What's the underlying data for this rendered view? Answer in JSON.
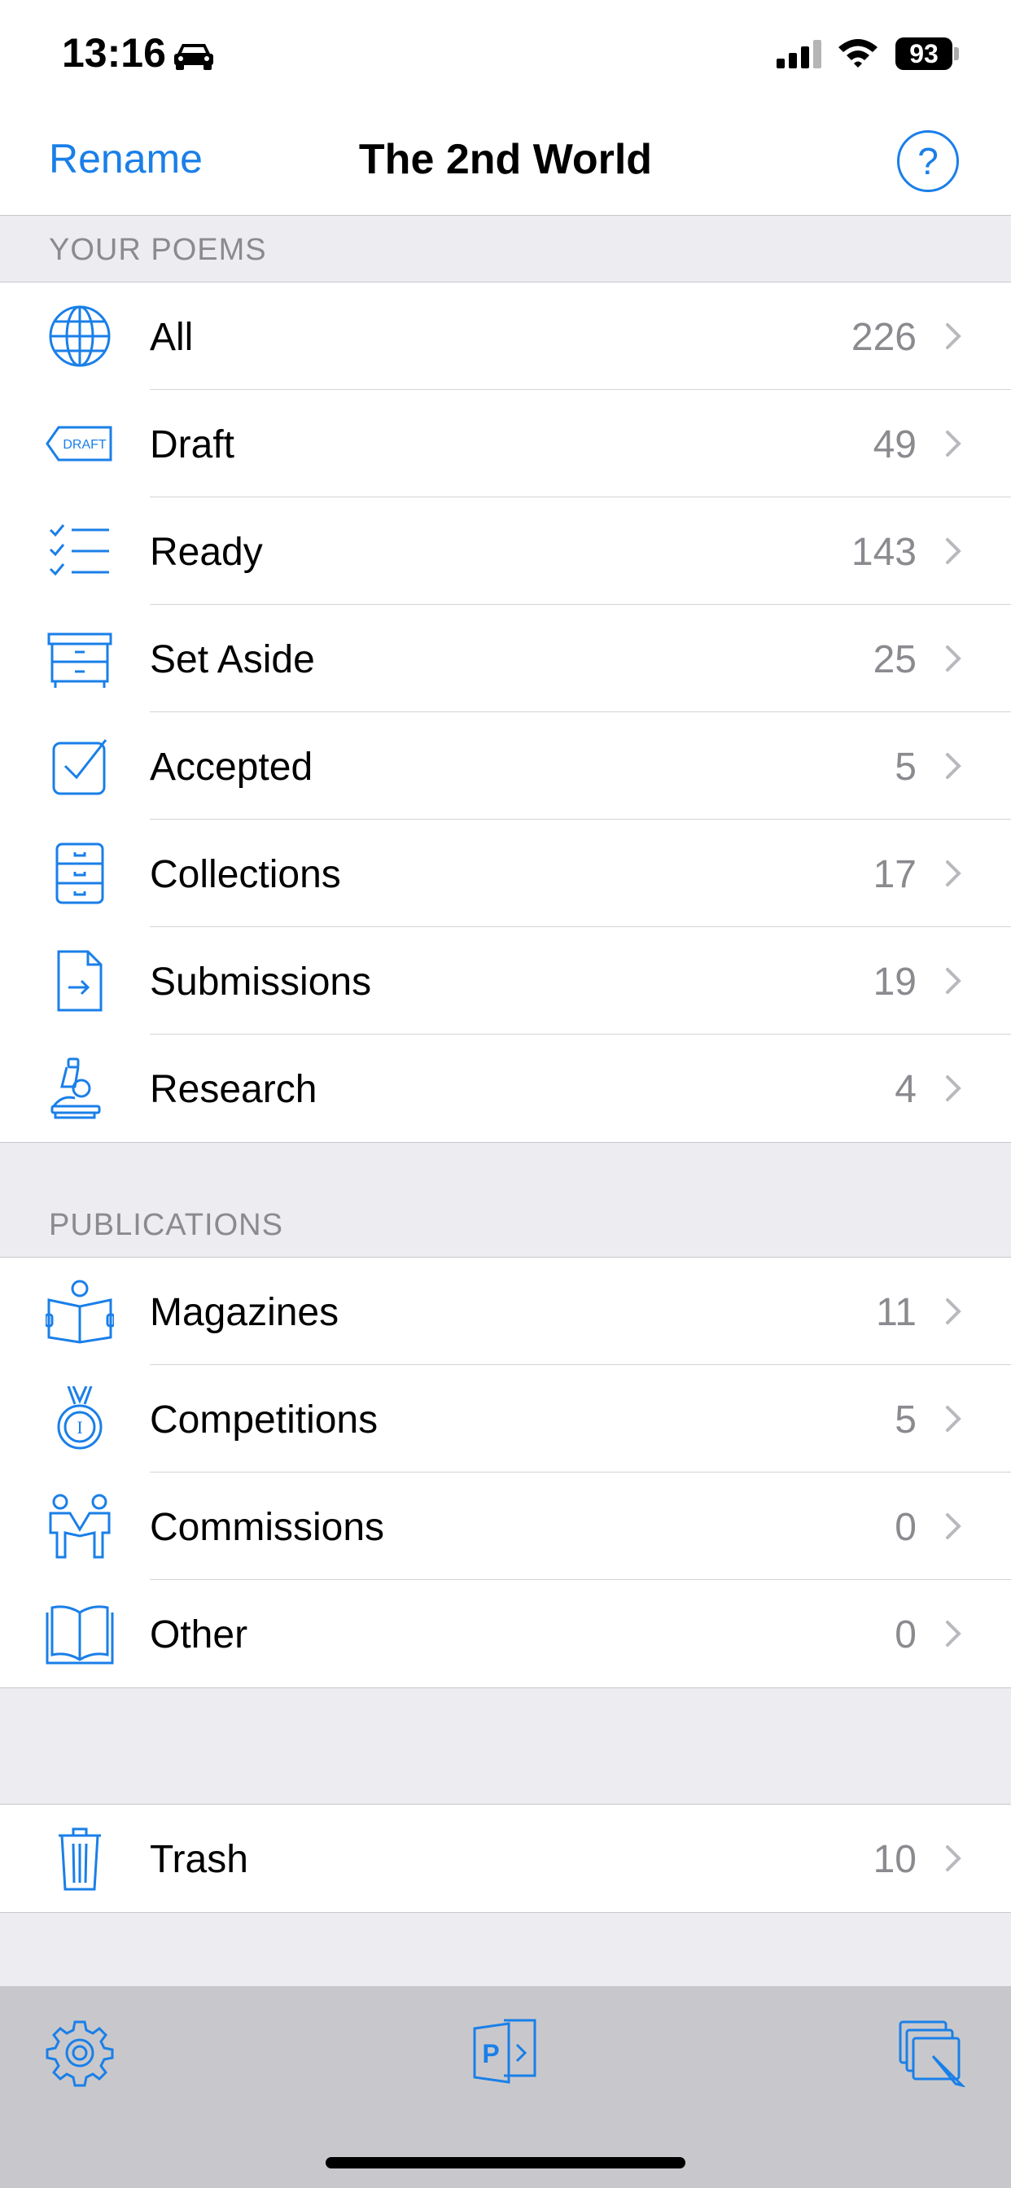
{
  "status": {
    "time": "13:16",
    "battery": "93"
  },
  "nav": {
    "left_label": "Rename",
    "title": "The 2nd World",
    "help": "?"
  },
  "colors": {
    "accent": "#1a7fe8"
  },
  "sections": [
    {
      "header": "YOUR POEMS",
      "items": [
        {
          "label": "All",
          "count": "226",
          "icon": "globe-icon"
        },
        {
          "label": "Draft",
          "count": "49",
          "icon": "draft-tag-icon",
          "icon_text": "DRAFT"
        },
        {
          "label": "Ready",
          "count": "143",
          "icon": "checklist-icon"
        },
        {
          "label": "Set Aside",
          "count": "25",
          "icon": "drawer-icon"
        },
        {
          "label": "Accepted",
          "count": "5",
          "icon": "checkbox-icon"
        },
        {
          "label": "Collections",
          "count": "17",
          "icon": "filing-cabinet-icon"
        },
        {
          "label": "Submissions",
          "count": "19",
          "icon": "document-arrow-icon"
        },
        {
          "label": "Research",
          "count": "4",
          "icon": "microscope-icon"
        }
      ]
    },
    {
      "header": "PUBLICATIONS",
      "items": [
        {
          "label": "Magazines",
          "count": "11",
          "icon": "reader-icon"
        },
        {
          "label": "Competitions",
          "count": "5",
          "icon": "medal-icon",
          "icon_text": "I"
        },
        {
          "label": "Commissions",
          "count": "0",
          "icon": "handshake-people-icon"
        },
        {
          "label": "Other",
          "count": "0",
          "icon": "open-book-icon"
        }
      ]
    },
    {
      "header": "",
      "items": [
        {
          "label": "Trash",
          "count": "10",
          "icon": "trash-icon"
        }
      ]
    }
  ],
  "toolbar": {
    "items": [
      "gear-icon",
      "publish-icon",
      "edit-windows-icon"
    ],
    "publish_icon_text": "P"
  }
}
